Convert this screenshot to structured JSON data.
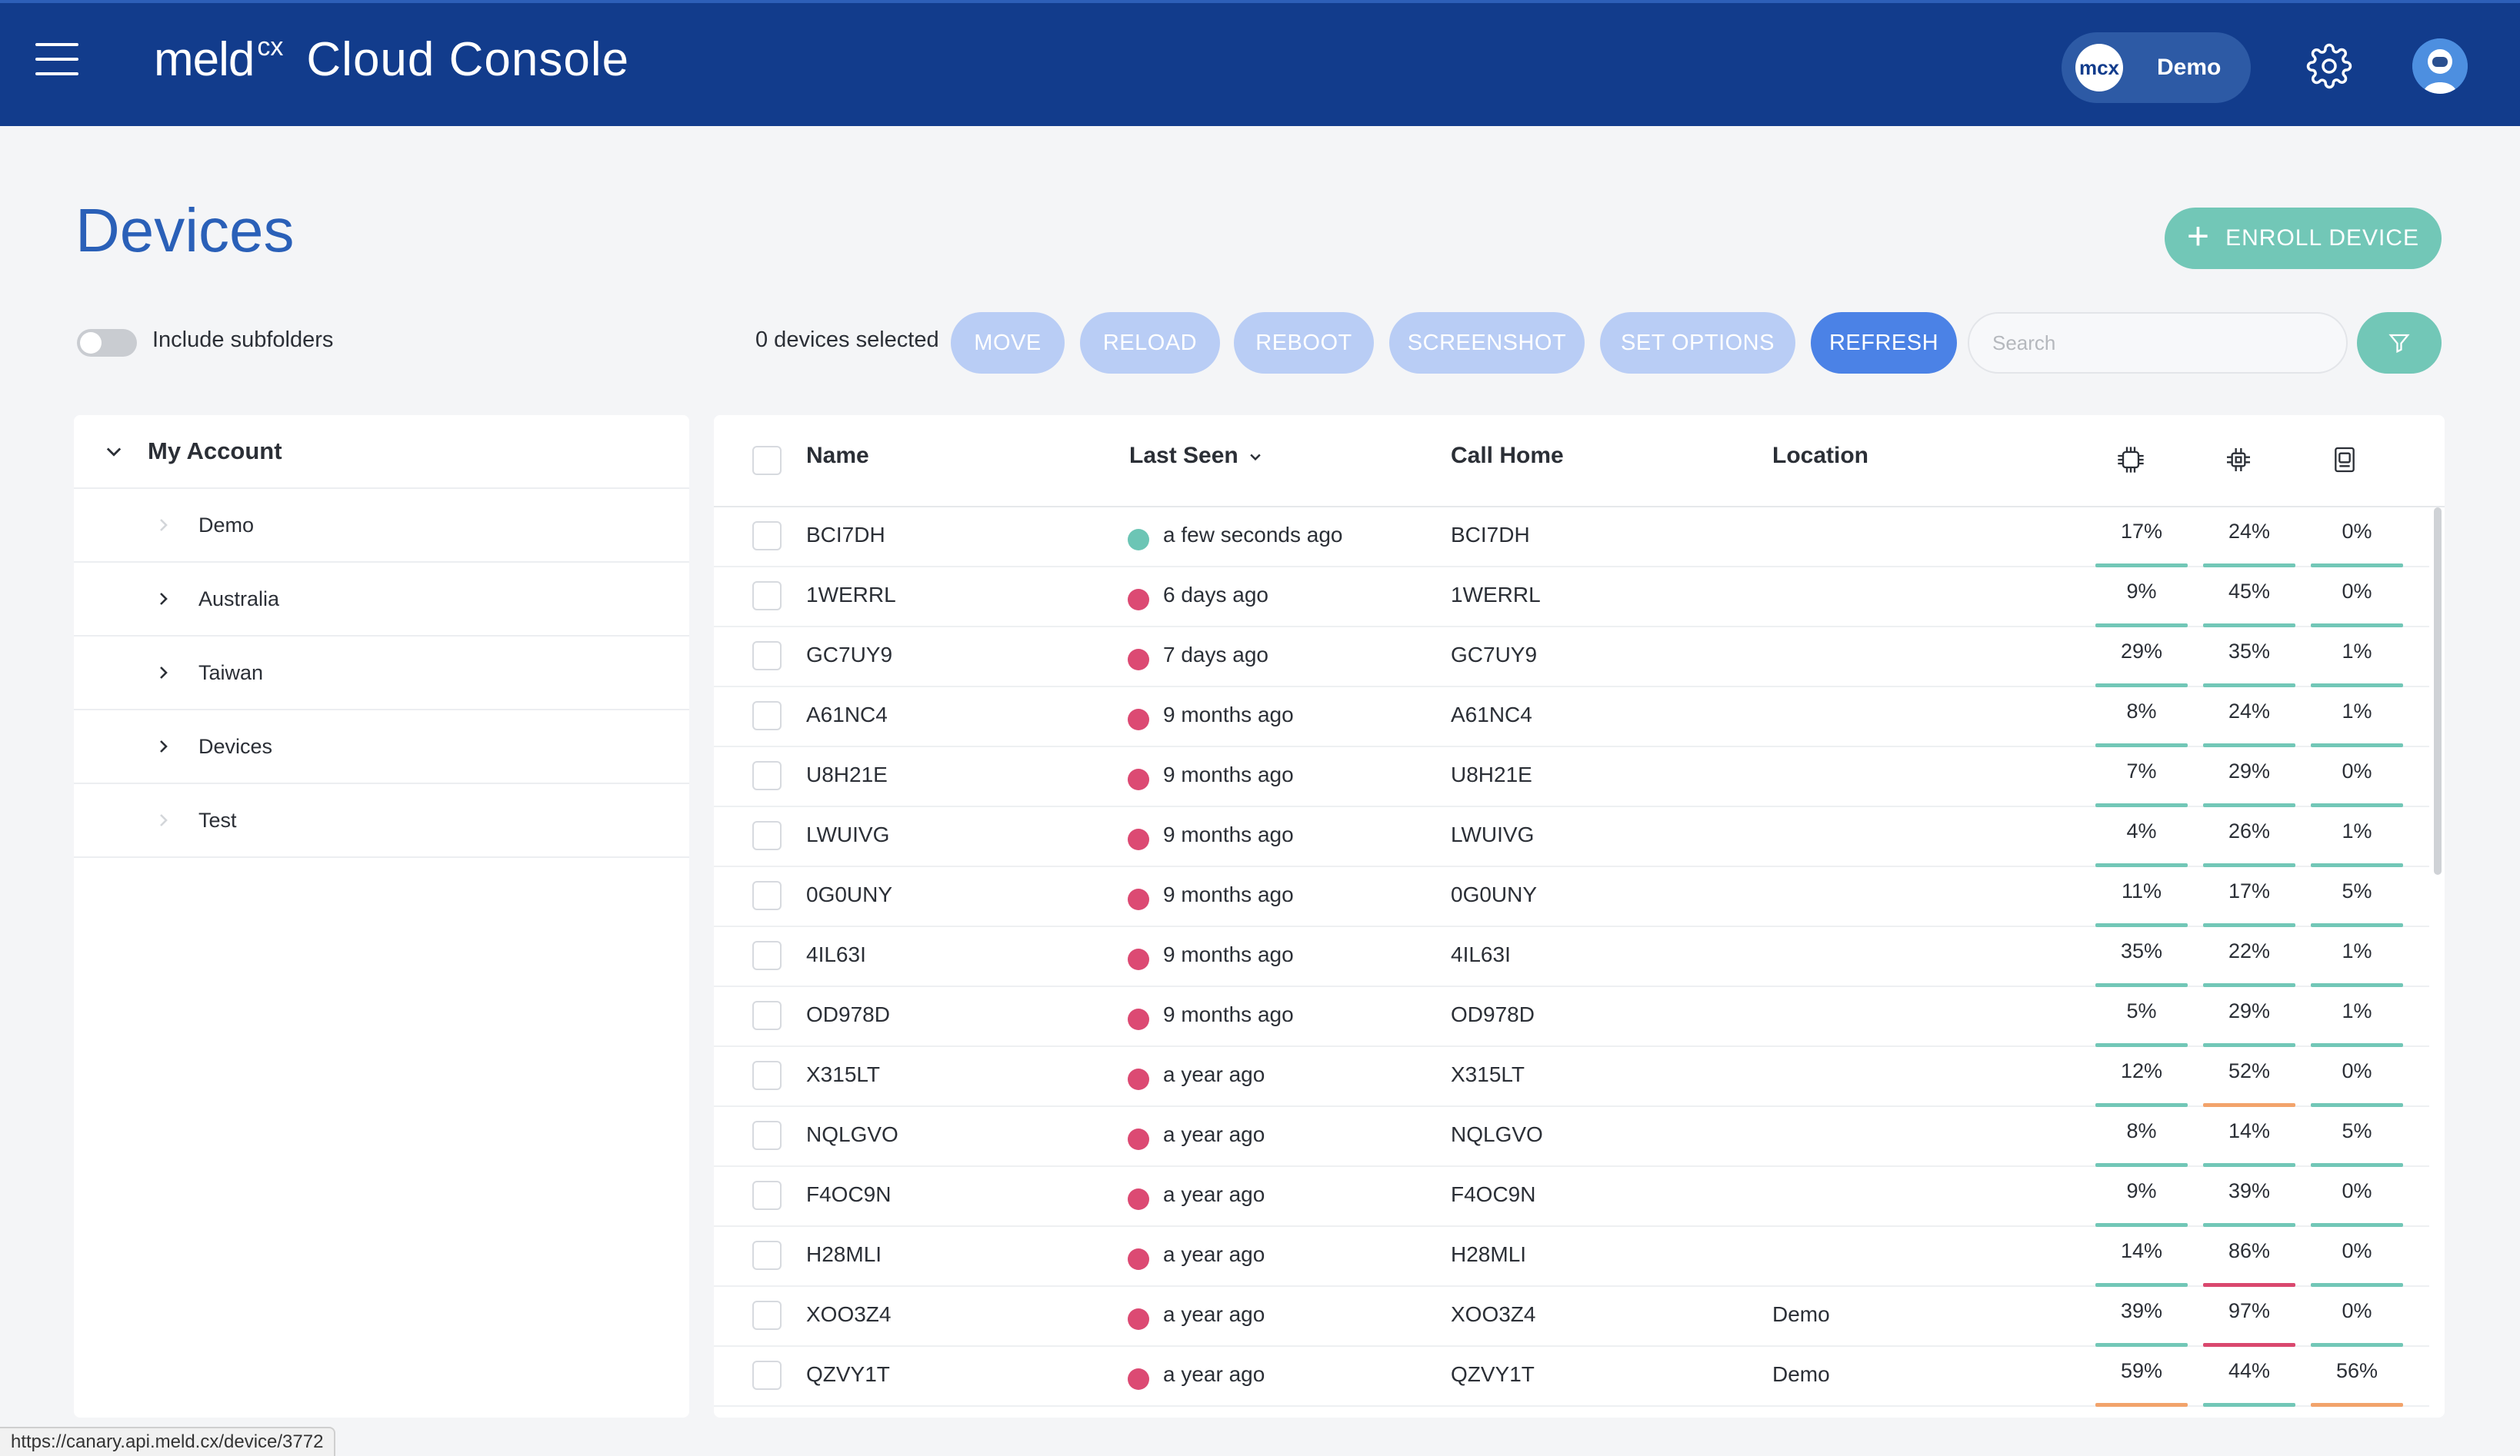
{
  "header": {
    "brand_logo": "meld",
    "brand_sup": "cx",
    "title": "Cloud Console",
    "org_logo": "mcx",
    "org_name": "Demo"
  },
  "page": {
    "title": "Devices",
    "enroll_label": "ENROLL DEVICE"
  },
  "toolbar": {
    "include_subfolders_label": "Include subfolders",
    "include_subfolders_on": false,
    "selected_count": "0 devices selected",
    "actions": [
      "MOVE",
      "RELOAD",
      "REBOOT",
      "SCREENSHOT",
      "SET OPTIONS",
      "REFRESH"
    ],
    "search_placeholder": "Search"
  },
  "tree": {
    "root": "My Account",
    "items": [
      {
        "label": "Demo",
        "expandable": false
      },
      {
        "label": "Australia",
        "expandable": true
      },
      {
        "label": "Taiwan",
        "expandable": true
      },
      {
        "label": "Devices",
        "expandable": true
      },
      {
        "label": "Test",
        "expandable": false
      }
    ]
  },
  "table": {
    "columns": {
      "name": "Name",
      "last_seen": "Last Seen",
      "call_home": "Call Home",
      "location": "Location"
    },
    "metric_icons": [
      "cpu-icon",
      "memory-chip-icon",
      "storage-icon"
    ],
    "rows": [
      {
        "name": "BCI7DH",
        "last_seen": "a few seconds ago",
        "status": "online",
        "call_home": "BCI7DH",
        "location": "",
        "cpu": "17%",
        "mem": "24%",
        "disk": "0%"
      },
      {
        "name": "1WERRL",
        "last_seen": "6 days ago",
        "status": "offline",
        "call_home": "1WERRL",
        "location": "",
        "cpu": "9%",
        "mem": "45%",
        "disk": "0%"
      },
      {
        "name": "GC7UY9",
        "last_seen": "7 days ago",
        "status": "offline",
        "call_home": "GC7UY9",
        "location": "",
        "cpu": "29%",
        "mem": "35%",
        "disk": "1%"
      },
      {
        "name": "A61NC4",
        "last_seen": "9 months ago",
        "status": "offline",
        "call_home": "A61NC4",
        "location": "",
        "cpu": "8%",
        "mem": "24%",
        "disk": "1%"
      },
      {
        "name": "U8H21E",
        "last_seen": "9 months ago",
        "status": "offline",
        "call_home": "U8H21E",
        "location": "",
        "cpu": "7%",
        "mem": "29%",
        "disk": "0%"
      },
      {
        "name": "LWUIVG",
        "last_seen": "9 months ago",
        "status": "offline",
        "call_home": "LWUIVG",
        "location": "",
        "cpu": "4%",
        "mem": "26%",
        "disk": "1%"
      },
      {
        "name": "0G0UNY",
        "last_seen": "9 months ago",
        "status": "offline",
        "call_home": "0G0UNY",
        "location": "",
        "cpu": "11%",
        "mem": "17%",
        "disk": "5%"
      },
      {
        "name": "4IL63I",
        "last_seen": "9 months ago",
        "status": "offline",
        "call_home": "4IL63I",
        "location": "",
        "cpu": "35%",
        "mem": "22%",
        "disk": "1%"
      },
      {
        "name": "OD978D",
        "last_seen": "9 months ago",
        "status": "offline",
        "call_home": "OD978D",
        "location": "",
        "cpu": "5%",
        "mem": "29%",
        "disk": "1%"
      },
      {
        "name": "X315LT",
        "last_seen": "a year ago",
        "status": "offline",
        "call_home": "X315LT",
        "location": "",
        "cpu": "12%",
        "mem": "52%",
        "disk": "0%"
      },
      {
        "name": "NQLGVO",
        "last_seen": "a year ago",
        "status": "offline",
        "call_home": "NQLGVO",
        "location": "",
        "cpu": "8%",
        "mem": "14%",
        "disk": "5%"
      },
      {
        "name": "F4OC9N",
        "last_seen": "a year ago",
        "status": "offline",
        "call_home": "F4OC9N",
        "location": "",
        "cpu": "9%",
        "mem": "39%",
        "disk": "0%"
      },
      {
        "name": "H28MLI",
        "last_seen": "a year ago",
        "status": "offline",
        "call_home": "H28MLI",
        "location": "",
        "cpu": "14%",
        "mem": "86%",
        "disk": "0%"
      },
      {
        "name": "XOO3Z4",
        "last_seen": "a year ago",
        "status": "offline",
        "call_home": "XOO3Z4",
        "location": "Demo",
        "cpu": "39%",
        "mem": "97%",
        "disk": "0%"
      },
      {
        "name": "QZVY1T",
        "last_seen": "a year ago",
        "status": "offline",
        "call_home": "QZVY1T",
        "location": "Demo",
        "cpu": "59%",
        "mem": "44%",
        "disk": "56%"
      }
    ]
  },
  "colors": {
    "header_bg": "#123c8c",
    "accent_teal": "#72c7b7",
    "action_disabled": "#b9cdf5",
    "action_primary": "#4b82e6",
    "status_online": "#6cc5b5",
    "status_offline": "#dc4a73",
    "bar_low": "#72c7b7",
    "bar_mid": "#f2a36b",
    "bar_high": "#d9486e"
  },
  "status_url": "https://canary.api.meld.cx/device/3772"
}
